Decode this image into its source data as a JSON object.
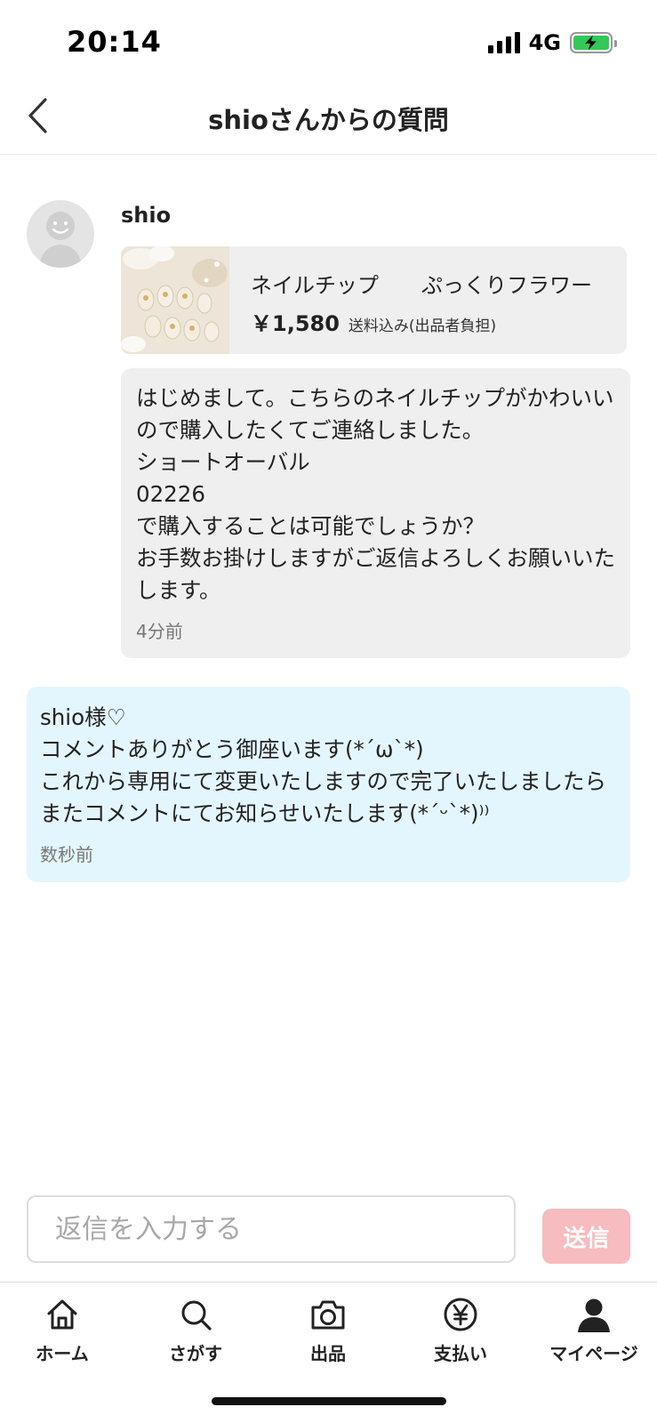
{
  "status_bar": {
    "time": "20:14",
    "network": "4G"
  },
  "header": {
    "title": "shioさんからの質問"
  },
  "question": {
    "author": "shio",
    "product": {
      "name": "ネイルチップ　　ぷっくりフラワー",
      "price": "￥1,580",
      "shipping": "送料込み(出品者負担)"
    },
    "message": "はじめまして。こちらのネイルチップがかわいいので購入したくてご連絡しました。\nショートオーバル\n02226\nで購入することは可能でしょうか？\nお手数お掛けしますがご返信よろしくお願いいたします。",
    "time": "4分前"
  },
  "reply": {
    "message": "shio様♡\nコメントありがとう御座います(*´ω`*)\nこれから専用にて変更いたしますので完了いたしましたらまたコメントにてお知らせいたします(*ˊᵕˋ*)⁾⁾",
    "time": "数秒前"
  },
  "input": {
    "placeholder": "返信を入力する",
    "send_label": "送信"
  },
  "tabs": [
    {
      "label": "ホーム",
      "icon": "home-icon"
    },
    {
      "label": "さがす",
      "icon": "search-icon"
    },
    {
      "label": "出品",
      "icon": "camera-icon"
    },
    {
      "label": "支払い",
      "icon": "yen-icon"
    },
    {
      "label": "マイページ",
      "icon": "person-icon"
    }
  ],
  "colors": {
    "send_button": "#f6bcbf",
    "reply_bubble": "#e4f6fd",
    "question_bubble": "#efefef",
    "battery": "#34c759"
  }
}
